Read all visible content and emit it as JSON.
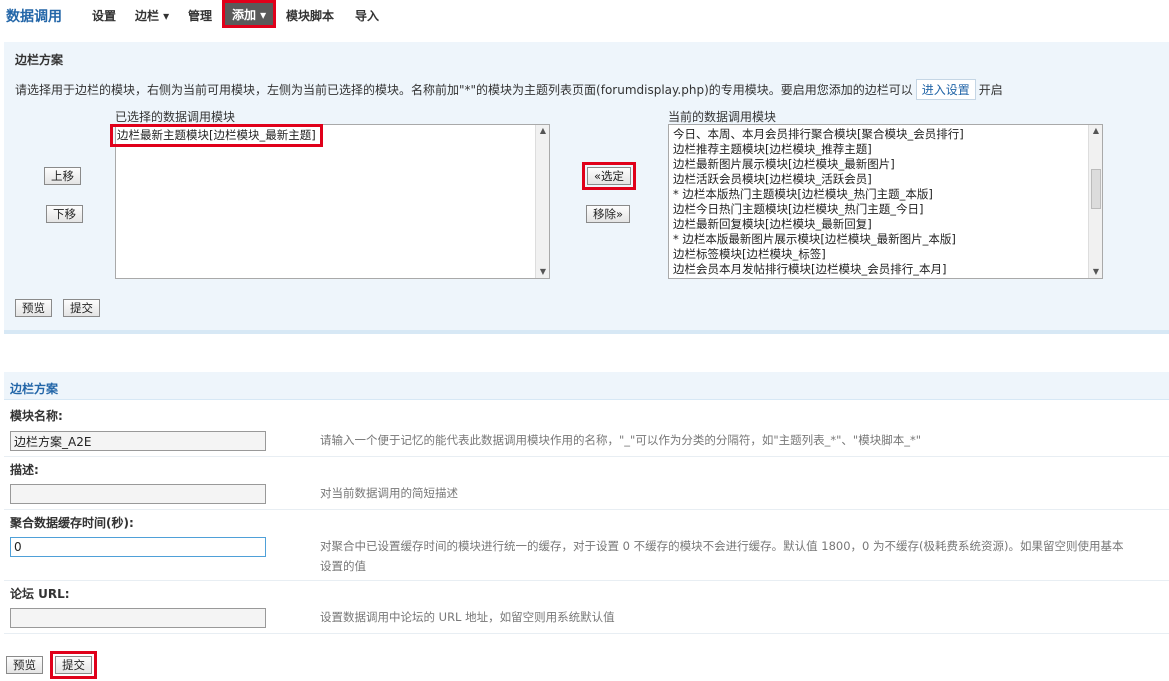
{
  "topnav": {
    "title": "数据调用",
    "items": [
      {
        "label": "设置"
      },
      {
        "label": "边栏 ▾"
      },
      {
        "label": "管理"
      },
      {
        "label": "添加 ▾"
      },
      {
        "label": "模块脚本"
      },
      {
        "label": "导入"
      }
    ]
  },
  "scheme": {
    "title": "边栏方案",
    "desc_before": "请选择用于边栏的模块，右侧为当前可用模块，左侧为当前已选择的模块。名称前加\"*\"的模块为主题列表页面(forumdisplay.php)的专用模块。要启用您添加的边栏可以",
    "desc_link": "进入设置",
    "desc_after": "开启",
    "selected_label": "已选择的数据调用模块",
    "available_label": "当前的数据调用模块",
    "selected_items": [
      "边栏最新主题模块[边栏模块_最新主题]"
    ],
    "available_items": [
      "今日、本周、本月会员排行聚合模块[聚合模块_会员排行]",
      "边栏推荐主题模块[边栏模块_推荐主题]",
      "边栏最新图片展示模块[边栏模块_最新图片]",
      "边栏活跃会员模块[边栏模块_活跃会员]",
      "* 边栏本版热门主题模块[边栏模块_热门主题_本版]",
      "边栏今日热门主题模块[边栏模块_热门主题_今日]",
      "边栏最新回复模块[边栏模块_最新回复]",
      "* 边栏本版最新图片展示模块[边栏模块_最新图片_本版]",
      "边栏标签模块[边栏模块_标签]",
      "边栏会员本月发帖排行模块[边栏模块_会员排行_本月]"
    ],
    "btn_up": "上移",
    "btn_down": "下移",
    "btn_select": "«选定",
    "btn_remove": "移除»",
    "btn_preview": "预览",
    "btn_submit": "提交"
  },
  "form": {
    "title": "边栏方案",
    "name_label": "模块名称:",
    "name_value": "边栏方案_A2E",
    "name_hint": "请输入一个便于记忆的能代表此数据调用模块作用的名称，\"_\"可以作为分类的分隔符，如\"主题列表_*\"、\"模块脚本_*\"",
    "desc_label": "描述:",
    "desc_value": "",
    "desc_hint": "对当前数据调用的简短描述",
    "cache_label": "聚合数据缓存时间(秒):",
    "cache_value": "0",
    "cache_hint_1": "对聚合中已设置缓存时间的模块进行统一的缓存，对于设置 0 不缓存的模块不会进行缓存。默认值 1800，0 为不缓存(极耗费系统资源)。如果留空则使用基本",
    "cache_hint_2": "设置的值",
    "url_label": "论坛 URL:",
    "url_value": "",
    "url_hint": "设置数据调用中论坛的 URL 地址，如留空则用系统默认值",
    "btn_preview": "预览",
    "btn_submit": "提交"
  }
}
